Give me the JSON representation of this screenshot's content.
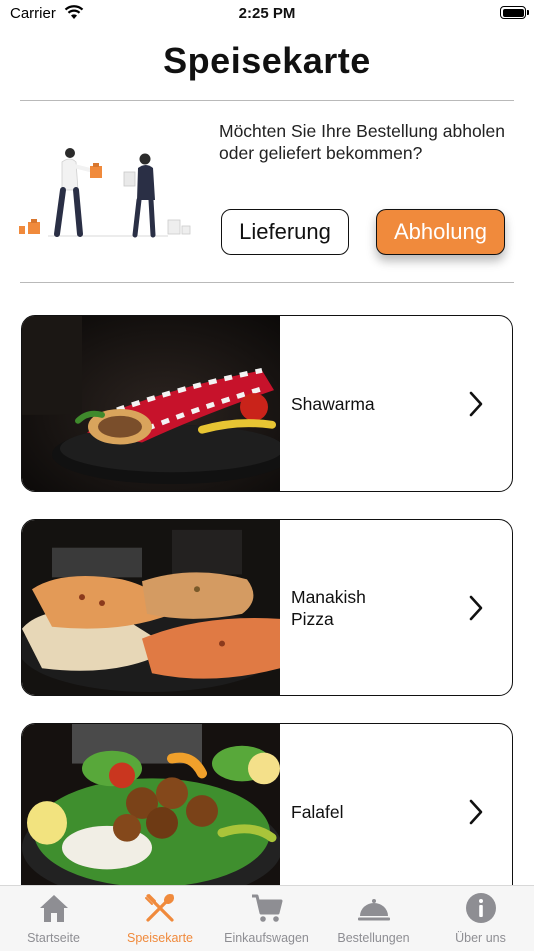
{
  "status_bar": {
    "carrier": "Carrier",
    "time": "2:25 PM"
  },
  "page": {
    "title": "Speisekarte"
  },
  "order_mode": {
    "question": "Möchten Sie Ihre Bestellung abholen oder geliefert bekommen?",
    "delivery_label": "Lieferung",
    "pickup_label": "Abholung",
    "selected": "Abholung",
    "accent_color": "#f08a3c"
  },
  "menu": {
    "items": [
      {
        "name": "Shawarma",
        "icon": "chevron-right-icon"
      },
      {
        "name": "Manakish\nPizza",
        "icon": "chevron-right-icon"
      },
      {
        "name": "Falafel",
        "icon": "chevron-right-icon"
      }
    ]
  },
  "tab_bar": {
    "active_color": "#f08a3c",
    "inactive_color": "#8e8e93",
    "tabs": [
      {
        "label": "Startseite",
        "icon": "house-icon"
      },
      {
        "label": "Speisekarte",
        "icon": "fork-spoon-icon",
        "active": true
      },
      {
        "label": "Einkaufswagen",
        "icon": "cart-icon"
      },
      {
        "label": "Bestellungen",
        "icon": "cloche-icon"
      },
      {
        "label": "Über uns",
        "icon": "info-icon"
      }
    ]
  }
}
